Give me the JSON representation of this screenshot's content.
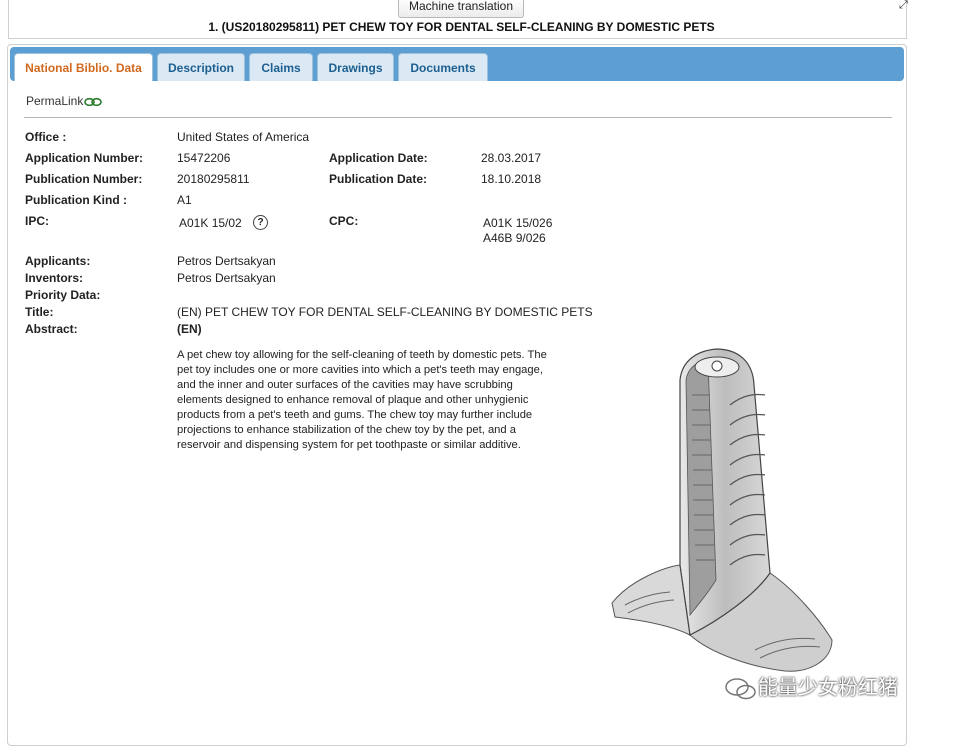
{
  "header": {
    "machine_translation_label": "Machine translation",
    "title": "1. (US20180295811) PET CHEW TOY FOR DENTAL SELF-CLEANING BY DOMESTIC PETS"
  },
  "tabs": [
    {
      "label": "National Biblio. Data",
      "active": true
    },
    {
      "label": "Description",
      "active": false
    },
    {
      "label": "Claims",
      "active": false
    },
    {
      "label": "Drawings",
      "active": false
    },
    {
      "label": "Documents",
      "active": false
    }
  ],
  "permalink_label": "PermaLink",
  "biblio": {
    "office_label": "Office :",
    "office_value": "United States of America",
    "app_number_label": "Application Number:",
    "app_number_value": "15472206",
    "app_date_label": "Application Date:",
    "app_date_value": "28.03.2017",
    "pub_number_label": "Publication Number:",
    "pub_number_value": "20180295811",
    "pub_date_label": "Publication Date:",
    "pub_date_value": "18.10.2018",
    "pub_kind_label": "Publication Kind :",
    "pub_kind_value": "A1",
    "ipc_label": "IPC:",
    "ipc_value": "A01K 15/02",
    "cpc_label": "CPC:",
    "cpc_values": [
      "A01K 15/026",
      "A46B 9/026"
    ],
    "applicants_label": "Applicants:",
    "applicants_value": "Petros Dertsakyan",
    "inventors_label": "Inventors:",
    "inventors_value": "Petros Dertsakyan",
    "priority_label": "Priority Data:",
    "title_label": "Title:",
    "title_value": "(EN) PET CHEW TOY FOR DENTAL SELF-CLEANING BY DOMESTIC PETS",
    "abstract_label": "Abstract:",
    "abstract_lang": "(EN)",
    "abstract_text": "A pet chew toy allowing for the self-cleaning of teeth by domestic pets. The pet toy includes one or more cavities into which a pet's teeth may engage, and the inner and outer surfaces of the cavities may have scrubbing elements designed to enhance removal of plaque and other unhygienic products from a pet's teeth and gums. The chew toy may further include projections to enhance stabilization of the chew toy by the pet, and a reservoir and dispensing system for pet toothpaste or similar additive."
  },
  "watermark_text": "能量少女粉红猪",
  "icons": {
    "help": "question-circle-icon",
    "link": "chain-link-icon",
    "expand": "expand-arrow-icon",
    "wechat": "wechat-icon"
  },
  "colors": {
    "tabbar": "#5d9ed3",
    "active_tab_text": "#d2691e",
    "tab_text": "#1d5f90"
  }
}
